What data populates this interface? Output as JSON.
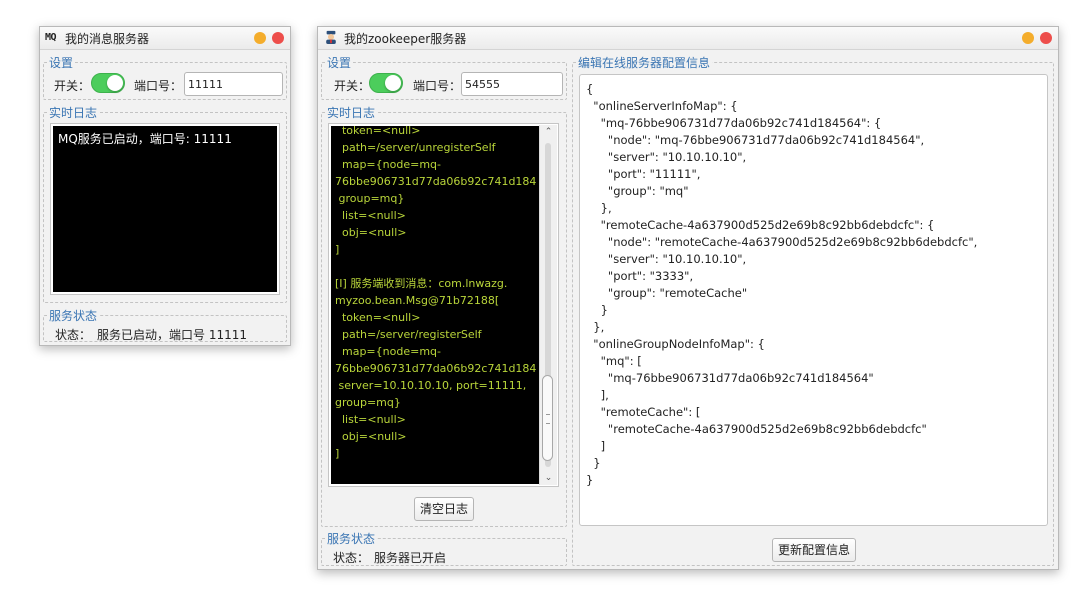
{
  "mq_window": {
    "icon_text": "MQ",
    "title": "我的消息服务器",
    "settings_legend": "设置",
    "switch_label": "开关：",
    "port_label": "端口号：",
    "port_value": "11111",
    "log_legend": "实时日志",
    "log_text": "MQ服务已启动，端口号: 11111",
    "status_legend": "服务状态",
    "status_label": "状态：",
    "status_text": "服务已启动，端口号 11111"
  },
  "zk_window": {
    "icon_name": "admin-icon",
    "title": "我的zookeeper服务器",
    "settings_legend": "设置",
    "switch_label": "开关：",
    "port_label": "端口号：",
    "port_value": "54555",
    "log_legend": "实时日志",
    "log_text": "  token=<null>\n  path=/server/unregisterSelf\n  map={node=mq-\n76bbe906731d77da06b92c741d184\n group=mq}\n  list=<null>\n  obj=<null>\n]\n\n[I] 服务端收到消息：com.lnwazg.\nmyzoo.bean.Msg@71b72188[\n  token=<null>\n  path=/server/registerSelf\n  map={node=mq-\n76bbe906731d77da06b92c741d184\n server=10.10.10.10, port=11111,\ngroup=mq}\n  list=<null>\n  obj=<null>\n]",
    "clear_button": "清空日志",
    "status_legend": "服务状态",
    "status_label": "状态：",
    "status_text": "服务器已开启",
    "config_legend": "编辑在线服务器配置信息",
    "config_json": "{\n  \"onlineServerInfoMap\": {\n    \"mq-76bbe906731d77da06b92c741d184564\": {\n      \"node\": \"mq-76bbe906731d77da06b92c741d184564\",\n      \"server\": \"10.10.10.10\",\n      \"port\": \"11111\",\n      \"group\": \"mq\"\n    },\n    \"remoteCache-4a637900d525d2e69b8c92bb6debdcfc\": {\n      \"node\": \"remoteCache-4a637900d525d2e69b8c92bb6debdcfc\",\n      \"server\": \"10.10.10.10\",\n      \"port\": \"3333\",\n      \"group\": \"remoteCache\"\n    }\n  },\n  \"onlineGroupNodeInfoMap\": {\n    \"mq\": [\n      \"mq-76bbe906731d77da06b92c741d184564\"\n    ],\n    \"remoteCache\": [\n      \"remoteCache-4a637900d525d2e69b8c92bb6debdcfc\"\n    ]\n  }\n}",
    "update_button": "更新配置信息"
  },
  "colors": {
    "legend": "#3a75b3",
    "toggle_on": "#4ccd5c",
    "log_text_zk": "#b9d53a",
    "minimize": "#f4ad2c",
    "close": "#ed4e4b"
  }
}
